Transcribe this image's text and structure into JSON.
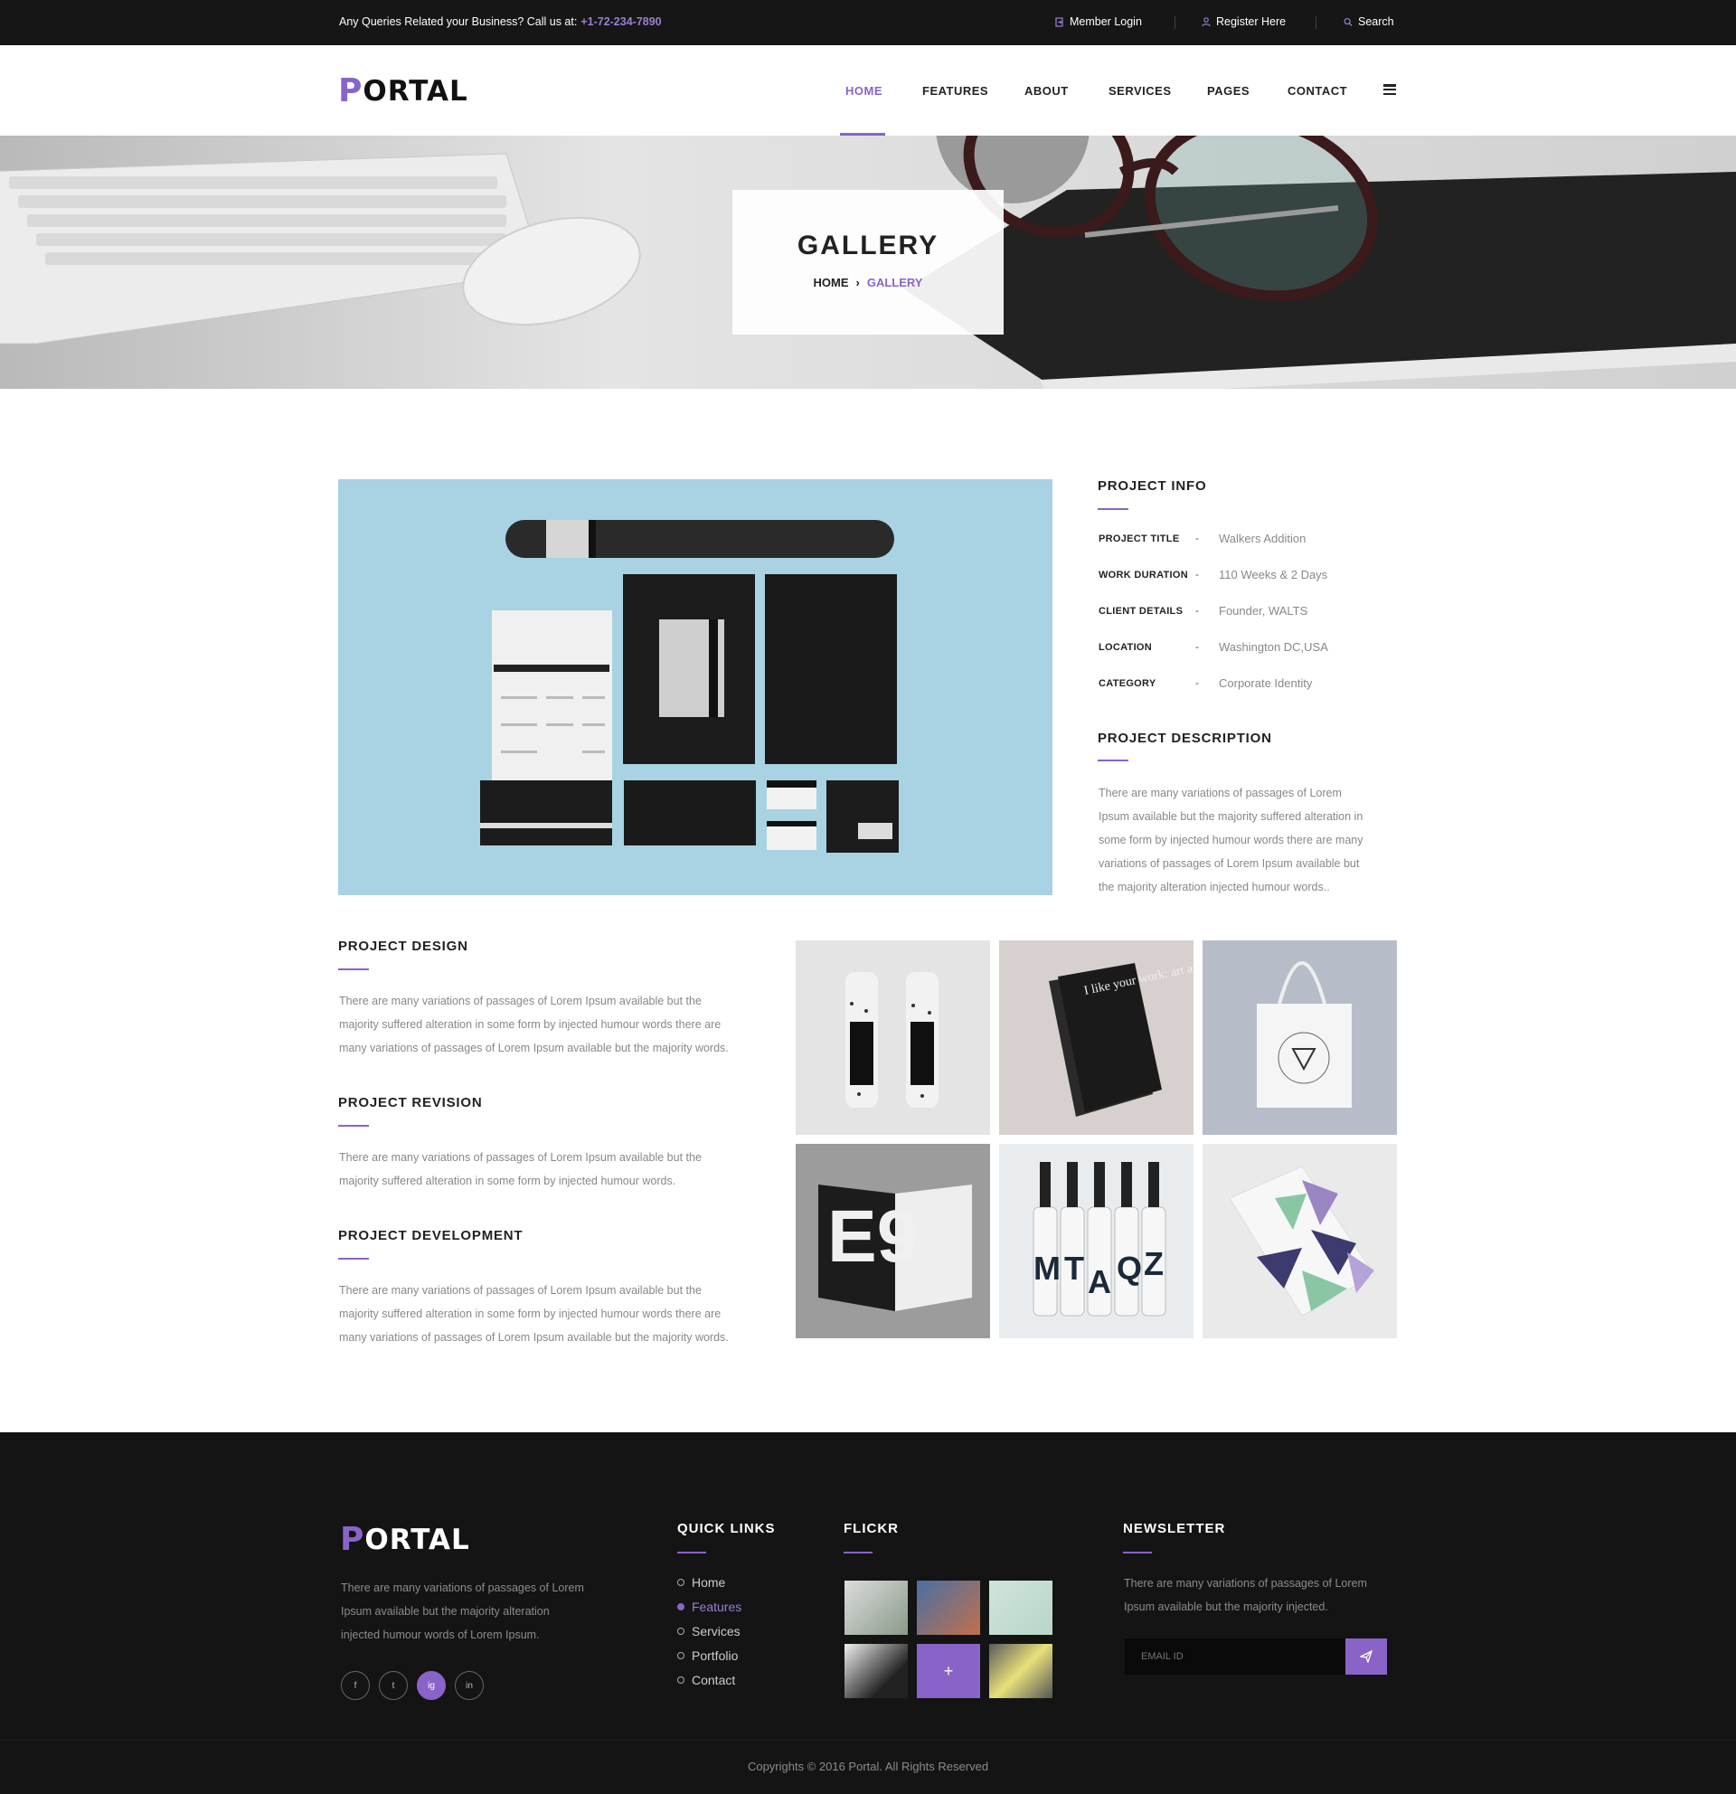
{
  "topbar": {
    "query_text": "Any Queries Related your Business? Call us at:",
    "phone": "+1-72-234-7890",
    "member_login": "Member Login",
    "register": "Register Here",
    "search": "Search"
  },
  "brand": {
    "logo_first": "P",
    "logo_rest": "ORTAL",
    "accent": "#8a63c9"
  },
  "nav": [
    "HOME",
    "FEATURES",
    "ABOUT",
    "SERVICES",
    "PAGES",
    "CONTACT"
  ],
  "hero": {
    "title": "GALLERY",
    "crumb_home": "HOME",
    "crumb_current": "GALLERY"
  },
  "project_info": {
    "heading": "PROJECT INFO",
    "rows": [
      {
        "label": "PROJECT TITLE",
        "value": "Walkers Addition"
      },
      {
        "label": "WORK DURATION",
        "value": "110 Weeks & 2 Days"
      },
      {
        "label": "CLIENT DETAILS",
        "value": "Founder, WALTS"
      },
      {
        "label": "LOCATION",
        "value": "Washington DC,USA"
      },
      {
        "label": "CATEGORY",
        "value": "Corporate Identity"
      }
    ]
  },
  "project_description": {
    "heading": "PROJECT DESCRIPTION",
    "lines": [
      "There are many variations of passages of Lorem",
      "Ipsum available but the majority suffered alteration in",
      "some form by injected humour words there are many",
      "variations of passages of Lorem Ipsum available but",
      "the majority alteration injected humour words.."
    ]
  },
  "design": {
    "heading": "PROJECT DESIGN",
    "lines": [
      "There are many variations of passages of Lorem Ipsum available but the",
      "majority suffered alteration in some form by injected humour words there are",
      "many variations of passages of Lorem Ipsum available but the majority words."
    ]
  },
  "revision": {
    "heading": "PROJECT REVISION",
    "lines": [
      "There are many variations of passages of Lorem Ipsum available but the",
      "majority suffered alteration in some form by injected humour words."
    ]
  },
  "development": {
    "heading": "PROJECT DEVELOPMENT",
    "lines": [
      "There are many variations of passages of Lorem Ipsum available but the",
      "majority suffered alteration in some form by injected humour words there are",
      "many variations of passages of Lorem Ipsum available but the majority words."
    ]
  },
  "mockups": {
    "book_text": "I like your work: art and etiquette",
    "magazine_text": "E9",
    "bottle_letters": [
      "M",
      "T",
      "A",
      "Q",
      "Z"
    ]
  },
  "footer": {
    "about_lines": [
      "There are many variations of passages of Lorem",
      "Ipsum available but the majority alteration",
      "injected humour words of Lorem Ipsum."
    ],
    "social": [
      "f",
      "t",
      "ig",
      "in"
    ],
    "quick_links_heading": "QUICK LINKS",
    "quick_links": [
      "Home",
      "Features",
      "Services",
      "Portfolio",
      "Contact"
    ],
    "flickr_heading": "FLICKR",
    "flickr_plus": "+",
    "newsletter_heading": "NEWSLETTER",
    "newsletter_lines": [
      "There are many variations of passages of Lorem",
      "Ipsum available but the majority injected."
    ],
    "email_placeholder": "EMAIL ID",
    "copyright": "Copyrights © 2016 Portal. All Rights Reserved"
  }
}
